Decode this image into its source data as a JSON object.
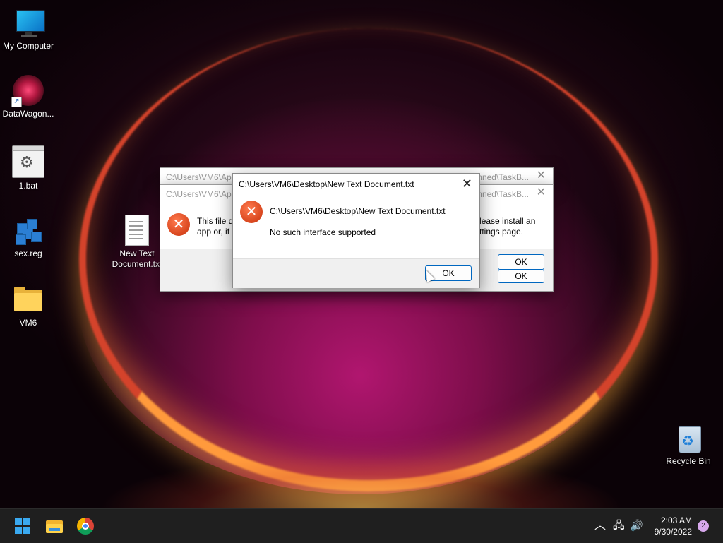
{
  "desktop": {
    "icons": [
      {
        "label": "My Computer",
        "icon": "monitor-icon"
      },
      {
        "label": "DataWagon...",
        "icon": "datawagon-icon"
      },
      {
        "label": "1.bat",
        "icon": "batch-file-icon"
      },
      {
        "label": "sex.reg",
        "icon": "registry-file-icon"
      },
      {
        "label": "VM6",
        "icon": "folder-icon"
      },
      {
        "label": "New Text Document.txt",
        "icon": "text-document-icon"
      },
      {
        "label": "Recycle Bin",
        "icon": "recycle-bin-icon"
      }
    ]
  },
  "background_dialogs": [
    {
      "title_left": "C:\\Users\\VM6\\Ap",
      "title_right": "nned\\TaskB..."
    },
    {
      "title_left": "C:\\Users\\VM6\\Ap",
      "title_right": "nned\\TaskB...",
      "message_left": "This file d",
      "message_left2": "app or, if",
      "message_right": "lease install an",
      "message_right2": "ttings page.",
      "ok_label": "OK"
    }
  ],
  "dialog": {
    "title": "C:\\Users\\VM6\\Desktop\\New Text Document.txt",
    "path": "C:\\Users\\VM6\\Desktop\\New Text Document.txt",
    "message": "No such interface supported",
    "ok_label": "OK",
    "close_glyph": "✕"
  },
  "taskbar": {
    "apps": [
      "Start",
      "File Explorer",
      "Google Chrome"
    ],
    "time": "2:03 AM",
    "date": "9/30/2022",
    "notification_count": "2"
  }
}
